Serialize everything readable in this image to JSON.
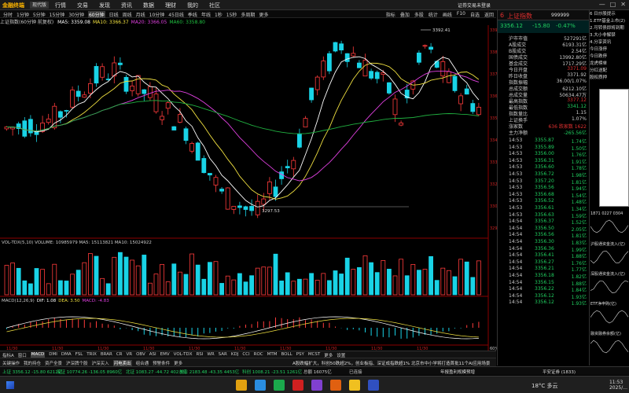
{
  "titlebar": {
    "logo": "金融终端",
    "edition": "现代版",
    "menus": [
      "行情",
      "交易",
      "发现",
      "资讯",
      "数据",
      "理财",
      "我的",
      "社区"
    ],
    "service": "证券交易未登录",
    "controls": [
      "—",
      "□",
      "✕"
    ]
  },
  "periodbar": {
    "periods": [
      "分时",
      "1分钟",
      "5分钟",
      "15分钟",
      "30分钟",
      "60分钟",
      "日线",
      "周线",
      "月线",
      "10分钟",
      "45日线",
      "季线",
      "年线",
      "1秒",
      "15秒",
      "多周期",
      "更多"
    ],
    "active": "60分钟",
    "tools": [
      "指标",
      "叠加",
      "多股",
      "统计",
      "画线",
      "F10",
      "自选",
      "返回"
    ]
  },
  "legend": {
    "title": "上证指数(60分钟 前复权)",
    "items": [
      {
        "label": "MA5: 3359.08",
        "color": "#ffffff"
      },
      {
        "label": "MA10: 3366.37",
        "color": "#f0e040"
      },
      {
        "label": "MA20: 3366.05",
        "color": "#e040e0"
      },
      {
        "label": "MA60: 3358.80",
        "color": "#20c040"
      }
    ]
  },
  "chart": {
    "colors": {
      "up": "#ff3b3b",
      "down": "#19d3e6",
      "ma5": "#ffffff",
      "ma10": "#f0e040",
      "ma20": "#e040e0",
      "ma60": "#20b040"
    },
    "high_label": "3392.41",
    "low_label": "3297.53",
    "price_axis": [
      "3395.00",
      "3384.35",
      "3373.70",
      "3363.05",
      "3352.40",
      "3341.75",
      "3331.10",
      "3320.45",
      "3309.80",
      "3299.15"
    ],
    "time_labels": [
      "11/30",
      "11/30",
      "11/30",
      "11/30",
      "11/30",
      "11/30",
      "11/30",
      "11/30",
      "11/30",
      "11/30"
    ],
    "unit": "60分钟"
  },
  "volume": {
    "legend": "VOL-TDX(5,10)  VOLUME: 10985979  MA5: 15113821  MA10: 15024922"
  },
  "macd": {
    "items": [
      {
        "label": "MACD(12,26,9)",
        "color": "#cccccc"
      },
      {
        "label": "DIF: 1.08",
        "color": "#ffffff"
      },
      {
        "label": "DEA: 3.50",
        "color": "#f0e040"
      },
      {
        "label": "MACD: -4.83",
        "color": "#e040e0"
      }
    ]
  },
  "indicators": {
    "items": [
      "指标A",
      "窗口",
      "MACD",
      "DMI",
      "DMA",
      "FSL",
      "TRIX",
      "BRAR",
      "CR",
      "VR",
      "OBV",
      "ASI",
      "EMV",
      "VOL-TDX",
      "RSI",
      "WR",
      "SAR",
      "KDJ",
      "CCI",
      "ROC",
      "MTM",
      "BOLL",
      "PSY",
      "MCST",
      "更多",
      "设置"
    ],
    "active": "MACD"
  },
  "toolbar2": {
    "items": [
      "关键操作",
      "我的持仓",
      "资产全景",
      "沪深牌个股",
      "沪深买入",
      "闪电卖出",
      "组合通",
      "预警条件",
      "更多"
    ],
    "selected": "闪电卖出",
    "news": "A股跌幅扩大，科创50跌超2%，创业板指、深证成指跌超1%     北京市中小学将打造首批11个AI应用场景"
  },
  "ticker": [
    {
      "label": "上证  3356.12  -15.80  6212亿",
      "color": "#20d060"
    },
    {
      "label": "深证  10774.26  -136.05  8960亿",
      "color": "#20d060"
    },
    {
      "label": "北证  1083.27  -44.72  402.5亿",
      "color": "#20d060"
    },
    {
      "label": "创业  2183.48  -43.35  4453亿",
      "color": "#20d060"
    },
    {
      "label": "科创  1008.21  -23.51  1261亿",
      "color": "#20d060"
    },
    {
      "label": "总额  16075亿",
      "color": "#cccccc"
    },
    {
      "label": "已连接",
      "color": "#cccccc"
    },
    {
      "label": "年报盈利规模预增",
      "color": "#dddddd"
    },
    {
      "label": "平安证券 (1833)",
      "color": "#dddddd"
    }
  ],
  "taskbar": {
    "weather": "18°C 多云",
    "time": "11:53",
    "date": "2025/..."
  },
  "right_panel": {
    "rank": "6",
    "name": "上证指数",
    "code": "999999",
    "price": "3356.12",
    "change": "-15.80",
    "pct": "-0.47%",
    "stats": [
      {
        "k": "沪市市值",
        "v": "527291亿",
        "color": "#cccccc"
      },
      {
        "k": "A股成交",
        "v": "6193.31亿",
        "color": "#cccccc"
      },
      {
        "k": "B股成交",
        "v": "2.54亿",
        "color": "#cccccc"
      },
      {
        "k": "国债成交",
        "v": "13992.80亿",
        "color": "#cccccc"
      },
      {
        "k": "基金成交",
        "v": "1717.29亿",
        "color": "#cccccc"
      },
      {
        "k": "今日开盘",
        "v": "3371.09",
        "color": "#e03030"
      },
      {
        "k": "昨日收盘",
        "v": "3371.92",
        "color": "#cccccc"
      },
      {
        "k": "指数振幅",
        "v": "36.00/1.07%",
        "color": "#cccccc"
      },
      {
        "k": "总成交额",
        "v": "6212.10亿",
        "color": "#cccccc"
      },
      {
        "k": "总成交量",
        "v": "50634.47万",
        "color": "#cccccc"
      },
      {
        "k": "最高指数",
        "v": "3377.12",
        "color": "#e03030"
      },
      {
        "k": "最低指数",
        "v": "3341.12",
        "color": "#20d060"
      },
      {
        "k": "指数量比",
        "v": "1.15",
        "color": "#cccccc"
      },
      {
        "k": "上证换手",
        "v": "1.07%",
        "color": "#cccccc"
      },
      {
        "k": "涨家数",
        "v": "636  跌家数  1622",
        "color": "#e03030"
      },
      {
        "k": "主力净额",
        "v": "-265.56亿",
        "color": "#20d060"
      }
    ],
    "ticks": [
      {
        "t": "14:53",
        "p": "3355.87",
        "v": "1.74亿"
      },
      {
        "t": "14:53",
        "p": "3355.89",
        "v": "1.50亿"
      },
      {
        "t": "14:53",
        "p": "3356.00",
        "v": "1.76亿"
      },
      {
        "t": "14:53",
        "p": "3356.31",
        "v": "1.91亿"
      },
      {
        "t": "14:53",
        "p": "3356.60",
        "v": "1.78亿"
      },
      {
        "t": "14:53",
        "p": "3356.72",
        "v": "1.98亿"
      },
      {
        "t": "14:53",
        "p": "3357.20",
        "v": "1.81亿"
      },
      {
        "t": "14:53",
        "p": "3356.56",
        "v": "1.94亿"
      },
      {
        "t": "14:53",
        "p": "3356.68",
        "v": "1.54亿"
      },
      {
        "t": "14:53",
        "p": "3356.52",
        "v": "1.48亿"
      },
      {
        "t": "14:53",
        "p": "3356.61",
        "v": "1.34亿"
      },
      {
        "t": "14:53",
        "p": "3356.63",
        "v": "1.59亿"
      },
      {
        "t": "14:54",
        "p": "3356.37",
        "v": "1.52亿"
      },
      {
        "t": "14:54",
        "p": "3356.50",
        "v": "2.05亿"
      },
      {
        "t": "14:54",
        "p": "3356.56",
        "v": "1.81亿"
      },
      {
        "t": "14:54",
        "p": "3356.30",
        "v": "1.83亿"
      },
      {
        "t": "14:54",
        "p": "3356.36",
        "v": "1.99亿"
      },
      {
        "t": "14:54",
        "p": "3356.41",
        "v": "1.88亿"
      },
      {
        "t": "14:54",
        "p": "3356.27",
        "v": "1.76亿"
      },
      {
        "t": "14:54",
        "p": "3356.21",
        "v": "1.77亿"
      },
      {
        "t": "14:54",
        "p": "3356.18",
        "v": "1.82亿"
      },
      {
        "t": "14:54",
        "p": "3356.15",
        "v": "1.88亿"
      },
      {
        "t": "14:54",
        "p": "3356.22",
        "v": "1.84亿"
      },
      {
        "t": "14:54",
        "p": "3356.12",
        "v": "1.93亿"
      },
      {
        "t": "14:54",
        "p": "3356.12",
        "v": "1.93亿"
      }
    ]
  },
  "far_panel": {
    "menu": [
      {
        "label": "6 日炒股提示",
        "hot": false
      },
      {
        "label": "1.ETF基金上市(2)",
        "hot": false
      },
      {
        "label": "2.可转债即将到期",
        "hot": false
      },
      {
        "label": "3.大小非解禁",
        "hot": false
      },
      {
        "label": "4.分享资讯",
        "hot": false
      },
      {
        "label": "今日涨停",
        "hot": false
      },
      {
        "label": "今日跌停",
        "hot": false
      },
      {
        "label": "龙虎榜单",
        "hot": false
      },
      {
        "label": "分红送配",
        "hot": false
      },
      {
        "label": "股权质押",
        "hot": false
      }
    ],
    "minis": [
      {
        "title": "1871  0227  0304"
      },
      {
        "title": "沪股通资金流入(亿)"
      },
      {
        "title": "深股通资金流入(亿)"
      },
      {
        "title": "ETF净申购(亿)"
      },
      {
        "title": "融资融券余额(亿)"
      }
    ]
  }
}
